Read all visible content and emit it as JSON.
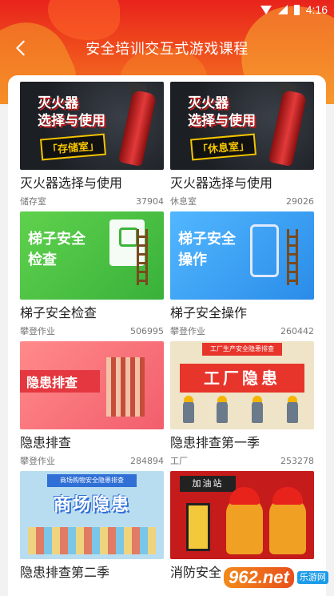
{
  "statusbar": {
    "time": "4:16"
  },
  "header": {
    "title": "安全培训交互式游戏课程",
    "back_icon": "chevron-left-icon"
  },
  "thumbs": {
    "extinguisher_text": "灭火器\n选择与使用",
    "storage_badge": "「存储室」",
    "rest_badge": "「休息室」",
    "ladder_check_text": "梯子安全\n检查",
    "ladder_op_text": "梯子安全\n操作",
    "hazard_text": "隐患排查",
    "factory_banner": "工厂生产安全隐患排查",
    "factory_text": "工厂隐患",
    "mall_banner": "商场购物安全隐患排查",
    "mall_text": "商场隐患",
    "gas_sign": "加油站"
  },
  "courses": [
    {
      "title": "灭火器选择与使用",
      "category": "储存室",
      "count": "37904"
    },
    {
      "title": "灭火器选择与使用",
      "category": "休息室",
      "count": "29026"
    },
    {
      "title": "梯子安全检查",
      "category": "攀登作业",
      "count": "506995"
    },
    {
      "title": "梯子安全操作",
      "category": "攀登作业",
      "count": "260442"
    },
    {
      "title": "隐患排查",
      "category": "攀登作业",
      "count": "284894"
    },
    {
      "title": "隐患排查第一季",
      "category": "工厂",
      "count": "253278"
    },
    {
      "title": "隐患排查第二季",
      "category": "",
      "count": ""
    },
    {
      "title": "消防安全",
      "category": "",
      "count": ""
    }
  ],
  "watermark": {
    "logo": "962.net",
    "sub": "乐游网"
  },
  "colors": {
    "header_red": "#e8231c",
    "header_orange": "#f47a22",
    "panel": "#ffffff"
  }
}
